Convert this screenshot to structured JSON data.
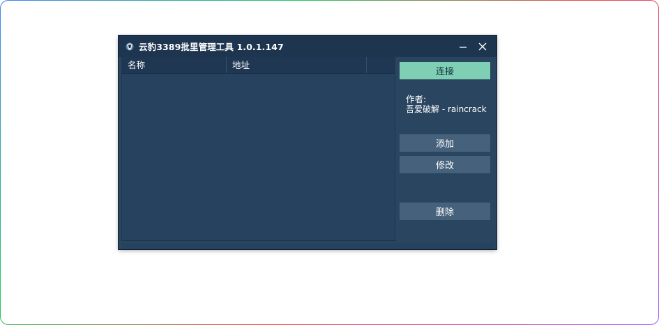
{
  "window": {
    "title": "云豹3389批里管理工具 1.0.1.147",
    "minimize_icon": "minimize-icon",
    "close_icon": "close-icon",
    "app_icon": "app-icon"
  },
  "list": {
    "columns": [
      "名称",
      "地址",
      ""
    ],
    "rows": []
  },
  "side": {
    "connect_label": "连接",
    "author_label": "作者:",
    "author_value": "吾爱破解  -   raincrack",
    "add_label": "添加",
    "edit_label": "修改",
    "delete_label": "删除"
  },
  "colors": {
    "window_bg": "#2a4560",
    "titlebar_bg": "#1e3550",
    "list_bg": "#26425e",
    "accent_button": "#7ecfb3",
    "button_bg": "#46617c"
  }
}
